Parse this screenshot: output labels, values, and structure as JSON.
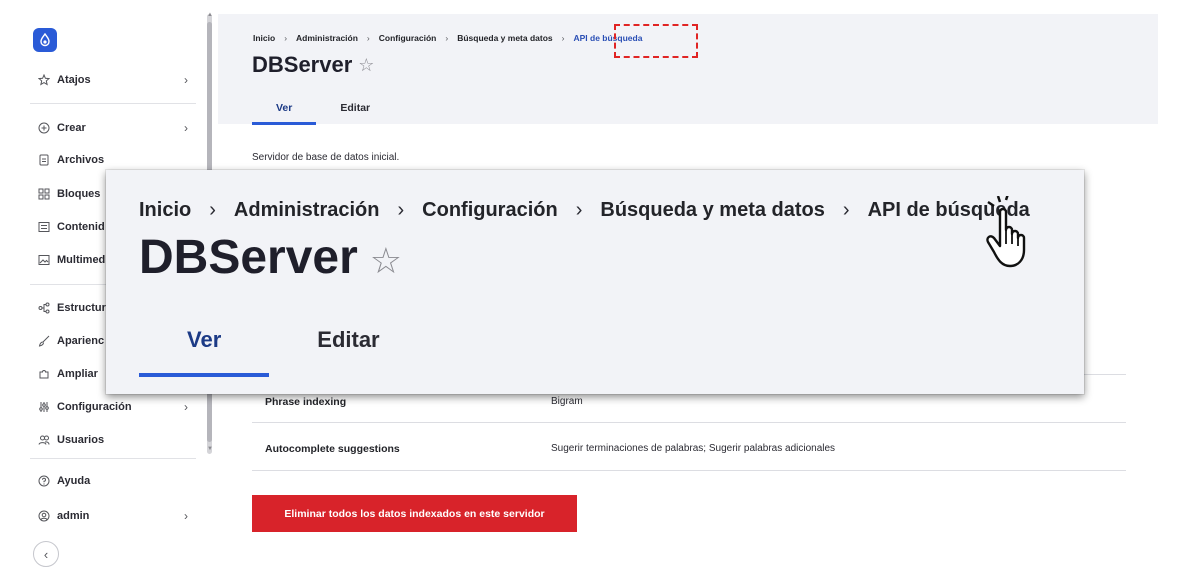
{
  "sidebar": {
    "items": [
      {
        "label": "Atajos",
        "icon": "star-icon",
        "chevron": "›"
      },
      {
        "label": "Crear",
        "icon": "plus-circle-icon",
        "chevron": "›"
      },
      {
        "label": "Archivos",
        "icon": "file-icon"
      },
      {
        "label": "Bloques",
        "icon": "blocks-icon"
      },
      {
        "label": "Contenid",
        "icon": "content-icon"
      },
      {
        "label": "Multimed",
        "icon": "media-icon"
      },
      {
        "label": "Estructur",
        "icon": "structure-icon"
      },
      {
        "label": "Aparienc",
        "icon": "brush-icon"
      },
      {
        "label": "Ampliar",
        "icon": "puzzle-icon"
      },
      {
        "label": "Configuración",
        "icon": "sliders-icon",
        "chevron": "›"
      },
      {
        "label": "Usuarios",
        "icon": "users-icon"
      },
      {
        "label": "Ayuda",
        "icon": "help-icon"
      },
      {
        "label": "admin",
        "icon": "user-icon",
        "chevron": "›"
      }
    ],
    "collapse_glyph": "‹"
  },
  "breadcrumb": {
    "items": [
      "Inicio",
      "Administración",
      "Configuración",
      "Búsqueda y meta datos",
      "API de búsqueda"
    ],
    "separator": "›"
  },
  "page": {
    "title": "DBServer",
    "star": "☆",
    "tabs": [
      "Ver",
      "Editar"
    ],
    "active_tab": "Ver",
    "description": "Servidor de base de datos inicial."
  },
  "table": {
    "rows": [
      {
        "label": "Phrase indexing",
        "value": "Bigram"
      },
      {
        "label": "Autocomplete suggestions",
        "value": "Sugerir terminaciones de palabras; Sugerir palabras adicionales"
      }
    ]
  },
  "actions": {
    "delete_label": "Eliminar todos los datos indexados en este servidor"
  },
  "zoom": {
    "breadcrumb": [
      "Inicio",
      "Administración",
      "Configuración",
      "Búsqueda y meta datos",
      "API de búsqueda"
    ],
    "title": "DBServer",
    "tabs": [
      "Ver",
      "Editar"
    ]
  },
  "colors": {
    "accent": "#2a5bd7",
    "active_tab_text": "#1c3a86",
    "danger": "#d8232a",
    "highlight": "#e02424",
    "header_bg": "#f2f3f7"
  }
}
